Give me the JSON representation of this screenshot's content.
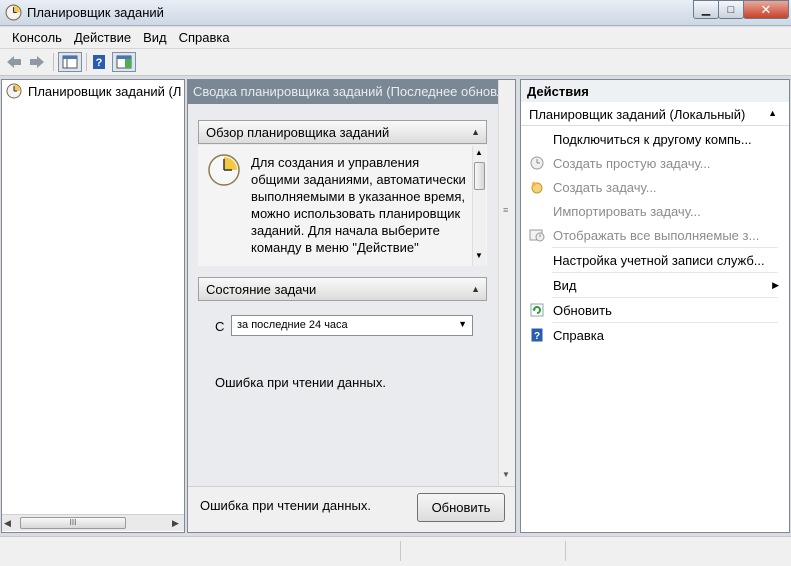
{
  "window": {
    "title": "Планировщик заданий",
    "minimize": "▁",
    "maximize": "□",
    "close": "✕"
  },
  "menu": [
    "Консоль",
    "Действие",
    "Вид",
    "Справка"
  ],
  "tree": {
    "root_label": "Планировщик заданий (Л"
  },
  "center": {
    "header": "Сводка планировщика заданий (Последнее обновлен",
    "overview": {
      "title": "Обзор планировщика заданий",
      "text": "Для создания и управления общими заданиями, автоматически выполняемыми в указанное время, можно использовать планировщик заданий. Для начала выберите команду в меню \"Действие\""
    },
    "status": {
      "title": "Состояние задачи",
      "filter_label": "С",
      "filter_value": "за последние 24 часа",
      "error_text": "Ошибка при чтении данных."
    },
    "footer": {
      "error_text": "Ошибка при чтении данных.",
      "refresh_button": "Обновить"
    }
  },
  "actions": {
    "title": "Действия",
    "group": "Планировщик заданий (Локальный)",
    "items": [
      {
        "label": "Подключиться к другому компь...",
        "disabled": false,
        "icon": "none"
      },
      {
        "label": "Создать простую задачу...",
        "disabled": true,
        "icon": "clock-icon"
      },
      {
        "label": "Создать задачу...",
        "disabled": true,
        "icon": "new-task-icon"
      },
      {
        "label": "Импортировать задачу...",
        "disabled": true,
        "icon": "none"
      },
      {
        "label": "Отображать все выполняемые з...",
        "disabled": true,
        "icon": "running-tasks-icon"
      },
      {
        "label": "Настройка учетной записи служб...",
        "disabled": false,
        "icon": "none"
      },
      {
        "label": "Вид",
        "disabled": false,
        "icon": "none"
      },
      {
        "label": "Обновить",
        "disabled": false,
        "icon": "refresh-icon"
      },
      {
        "label": "Справка",
        "disabled": false,
        "icon": "help-icon"
      }
    ]
  },
  "scroll": {
    "h_thumb": "III"
  },
  "colors": {
    "header_bg": "#7a8795",
    "link_blue": "#1a56c4"
  }
}
